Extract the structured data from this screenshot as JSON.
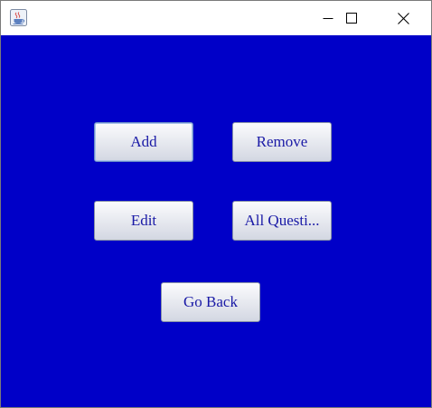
{
  "window": {
    "icons": {
      "app": "java-cup-icon",
      "minimize": "minimize-icon",
      "maximize": "maximize-icon",
      "close": "close-icon"
    }
  },
  "buttons": {
    "add": "Add",
    "remove": "Remove",
    "edit": "Edit",
    "all_questions": "All Questi...",
    "go_back": "Go Back"
  },
  "colors": {
    "background": "#0000c8",
    "button_text": "#1a1aa6"
  }
}
